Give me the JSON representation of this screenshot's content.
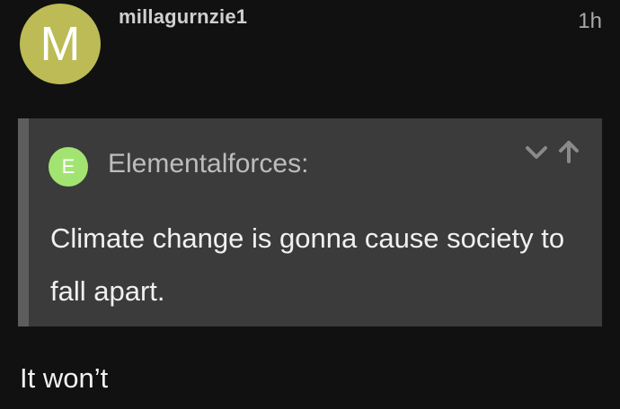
{
  "post": {
    "avatar_letter": "M",
    "username": "millagurnzie1",
    "timestamp": "1h",
    "quote": {
      "avatar_letter": "E",
      "author": "Elementalforces:",
      "text": "Climate change is gonna cause society to fall apart.",
      "controls": {
        "expand_icon": "chevron-down-icon",
        "jump_icon": "arrow-up-icon"
      }
    },
    "reply_text": "It won’t"
  },
  "colors": {
    "background": "#111111",
    "avatar_bg": "#bcbb55",
    "quote_avatar_bg": "#a2e472",
    "quote_bg": "#3b3b3b",
    "quote_border": "#5d5d5d"
  }
}
